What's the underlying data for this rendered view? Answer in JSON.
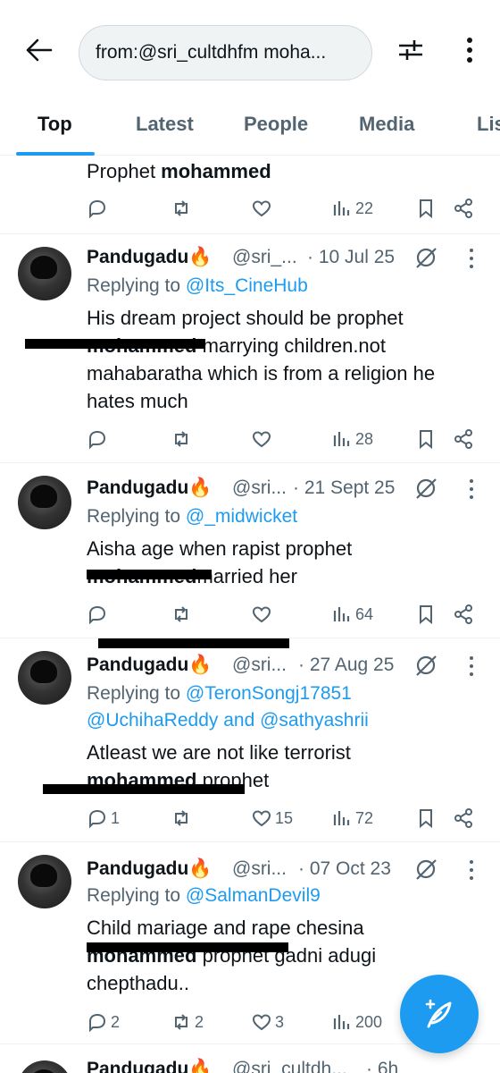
{
  "search": {
    "query": "from:@sri_cultdhfm moha..."
  },
  "tabs": [
    {
      "label": "Top",
      "active": true
    },
    {
      "label": "Latest"
    },
    {
      "label": "People"
    },
    {
      "label": "Media"
    },
    {
      "label": "Lis"
    }
  ],
  "partial_tweet": {
    "text_normal": "Prophet ",
    "text_bold": "mohammed",
    "views": "22"
  },
  "tweets": [
    {
      "name": "Pandugadu🔥",
      "handle": "@sri_...",
      "date": "· 10 Jul 25",
      "replying_prefix": "Replying to ",
      "replying_to": "@Its_CineHub",
      "line1": "His dream project should be prophet",
      "line2_bold": "mohammed",
      "line2_rest": " marrying children.not",
      "line3": "mahabaratha which is from a religion he",
      "line4": "hates much",
      "replies": "",
      "reposts": "",
      "likes": "",
      "views": "28"
    },
    {
      "name": "Pandugadu🔥",
      "handle": "@sri...",
      "date": "· 21 Sept 25",
      "replying_prefix": "Replying to ",
      "replying_to": "@_midwicket",
      "line1": "Aisha age when rapist prophet",
      "line2_bold": "mohammed",
      "line2_rest": "married her",
      "replies": "",
      "reposts": "",
      "likes": "",
      "views": "64"
    },
    {
      "name": "Pandugadu🔥",
      "handle": "@sri...",
      "date": "· 27 Aug 25",
      "replying_prefix": "Replying to ",
      "replying_to": "@TeronSongj17851",
      "replying_to_2": "@UchihaReddy and @sathyashrii",
      "line1": "Atleast we are not like terrorist",
      "line2_bold": "mohammed",
      "line2_rest": " prophet",
      "replies": "1",
      "reposts": "",
      "likes": "15",
      "views": "72"
    },
    {
      "name": "Pandugadu🔥",
      "handle": "@sri...",
      "date": "· 07 Oct 23",
      "replying_prefix": "Replying to ",
      "replying_to": "@SalmanDevil9",
      "line1": "Child mariage and rape chesina",
      "line2_bold": "mohammed",
      "line2_rest": " prophet gadni adugi",
      "line3": "chepthadu..",
      "replies": "2",
      "reposts": "2",
      "likes": "3",
      "views": "200"
    },
    {
      "name": "Pandugadu🔥",
      "handle": "@sri_cultdh...",
      "date": "· 6h"
    }
  ],
  "colors": {
    "accent": "#1d9bf0",
    "secondary_text": "#536471",
    "primary_text": "#0f1419"
  },
  "icons": [
    "back-arrow-icon",
    "filter-sliders-icon",
    "vertical-dots-icon",
    "reply-icon",
    "repost-icon",
    "like-icon",
    "views-icon",
    "bookmark-icon",
    "share-icon",
    "grok-icon",
    "compose-feather-icon"
  ]
}
